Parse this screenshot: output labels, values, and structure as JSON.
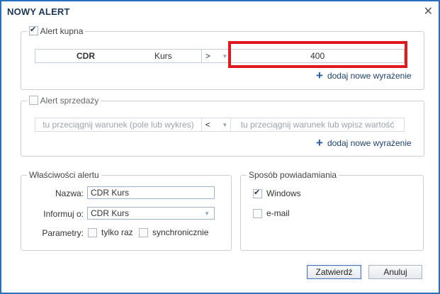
{
  "dialog": {
    "title": "NOWY ALERT",
    "close_glyph": "✕"
  },
  "buy_alert": {
    "legend": "Alert kupna",
    "checked": true,
    "symbol": "CDR",
    "field": "Kurs",
    "operator": ">",
    "value": "400",
    "add_link": "dodaj nowe wyrażenie",
    "highlight_color": "#e0191f"
  },
  "sell_alert": {
    "legend": "Alert sprzedaży",
    "checked": false,
    "condition_placeholder": "tu przeciągnij warunek (pole lub wykres)",
    "operator": "<",
    "value_placeholder": "tu przeciągnij warunek lub wpisz wartość",
    "add_link": "dodaj nowe wyrażenie"
  },
  "properties": {
    "legend": "Właściwości alertu",
    "name_label": "Nazwa:",
    "name_value": "CDR Kurs",
    "inform_label": "Informuj o:",
    "inform_value": "CDR Kurs",
    "params_label": "Parametry:",
    "once_label": "tylko raz",
    "sync_label": "synchronicznie"
  },
  "notify": {
    "legend": "Sposób powiadamiania",
    "windows_label": "Windows",
    "windows_checked": true,
    "email_label": "e-mail",
    "email_checked": false
  },
  "buttons": {
    "confirm": "Zatwierdź",
    "cancel": "Anuluj"
  }
}
